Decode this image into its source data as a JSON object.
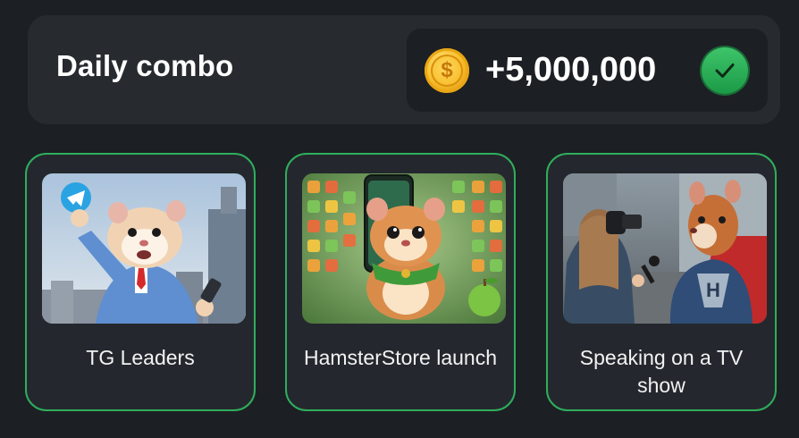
{
  "combo": {
    "title": "Daily combo",
    "reward": "+5,000,000",
    "coin_glyph": "$",
    "status_icon": "checkmark-icon",
    "accent_color": "#2fae5c"
  },
  "cards": [
    {
      "label": "TG Leaders",
      "image": "hamster-businessman-telegram"
    },
    {
      "label": "HamsterStore launch",
      "image": "hamster-app-store"
    },
    {
      "label": "Speaking on a TV show",
      "image": "hamster-superhero-interview"
    }
  ]
}
